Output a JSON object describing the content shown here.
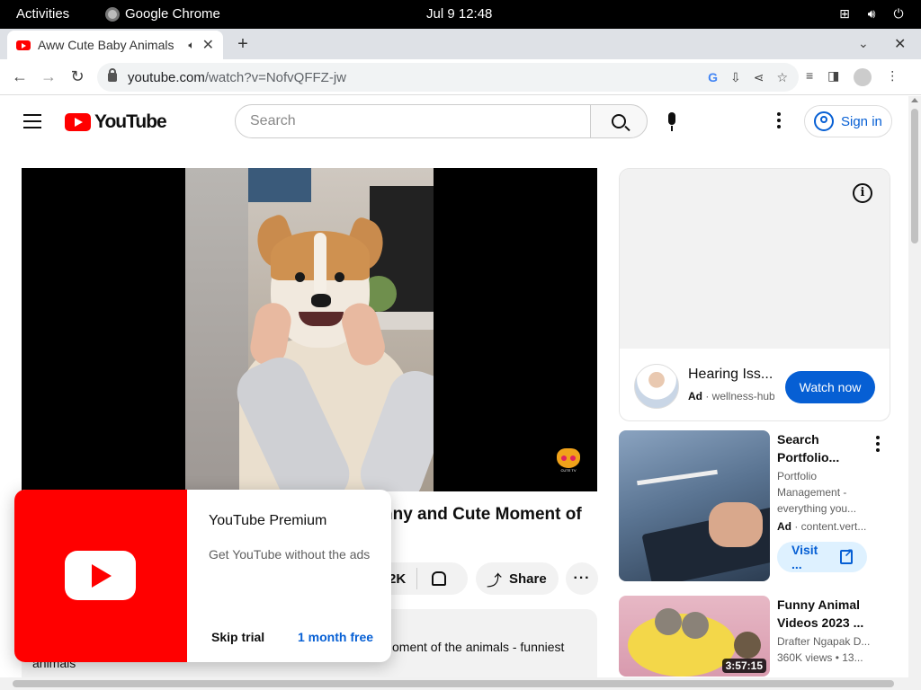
{
  "system": {
    "activities": "Activities",
    "app_name": "Google Chrome",
    "clock": "Jul 9  12:48"
  },
  "browser": {
    "tab_title": "Aww Cute Baby Animals",
    "url_host": "youtube.com",
    "url_path": "/watch?v=NofvQFFZ-jw"
  },
  "youtube": {
    "logo_text": "YouTube",
    "search_placeholder": "Search",
    "sign_in": "Sign in",
    "brand_color": "#ff0000",
    "link_color": "#065fd4"
  },
  "video": {
    "title_visible": "nny and Cute Moment of",
    "like_count": "2K",
    "share_label": "Share",
    "more_label": "···",
    "description_line1": "oment of the animals - funniest",
    "description_line2": "animals"
  },
  "ad": {
    "title": "Hearing Iss...",
    "badge": "Ad",
    "domain": "wellness-hub",
    "cta": "Watch now",
    "info_icon": "i"
  },
  "sidebar": {
    "items": [
      {
        "title": "Search\nPortfolio...",
        "subtitle": "Portfolio\nManagement -\neverything you...",
        "badge": "Ad",
        "domain": "content.vert...",
        "cta": "Visit ..."
      },
      {
        "title": "Funny Animal\nVideos 2023 ...",
        "channel": "Drafter Ngapak D...",
        "views": "360K views  •  13...",
        "duration": "3:57:15"
      }
    ]
  },
  "premium_popup": {
    "title": "YouTube Premium",
    "subtitle": "Get YouTube without the ads",
    "skip": "Skip trial",
    "offer": "1 month free"
  }
}
